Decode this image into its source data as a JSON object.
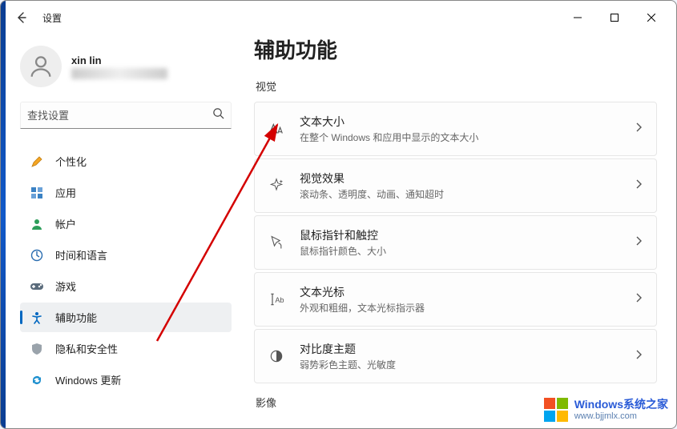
{
  "window": {
    "app_label": "设置",
    "page_title": "辅助功能"
  },
  "user": {
    "name": "xin lin"
  },
  "search": {
    "placeholder": "查找设置"
  },
  "nav": {
    "personalization": "个性化",
    "apps": "应用",
    "accounts": "帐户",
    "time_language": "时间和语言",
    "gaming": "游戏",
    "accessibility": "辅助功能",
    "privacy": "隐私和安全性",
    "update": "Windows 更新"
  },
  "sections": {
    "visual": "视觉",
    "video": "影像"
  },
  "cards": {
    "text_size": {
      "title": "文本大小",
      "sub": "在整个 Windows 和应用中显示的文本大小"
    },
    "visual_effects": {
      "title": "视觉效果",
      "sub": "滚动条、透明度、动画、通知超时"
    },
    "mouse_touch": {
      "title": "鼠标指针和触控",
      "sub": "鼠标指针颜色、大小"
    },
    "text_cursor": {
      "title": "文本光标",
      "sub": "外观和粗细，文本光标指示器"
    },
    "contrast": {
      "title": "对比度主题",
      "sub": "弱势彩色主题、光敏度"
    }
  },
  "watermark": {
    "brand": "Windows系统之家",
    "url": "www.bjjmlx.com"
  },
  "colors": {
    "accent": "#0067c0"
  }
}
